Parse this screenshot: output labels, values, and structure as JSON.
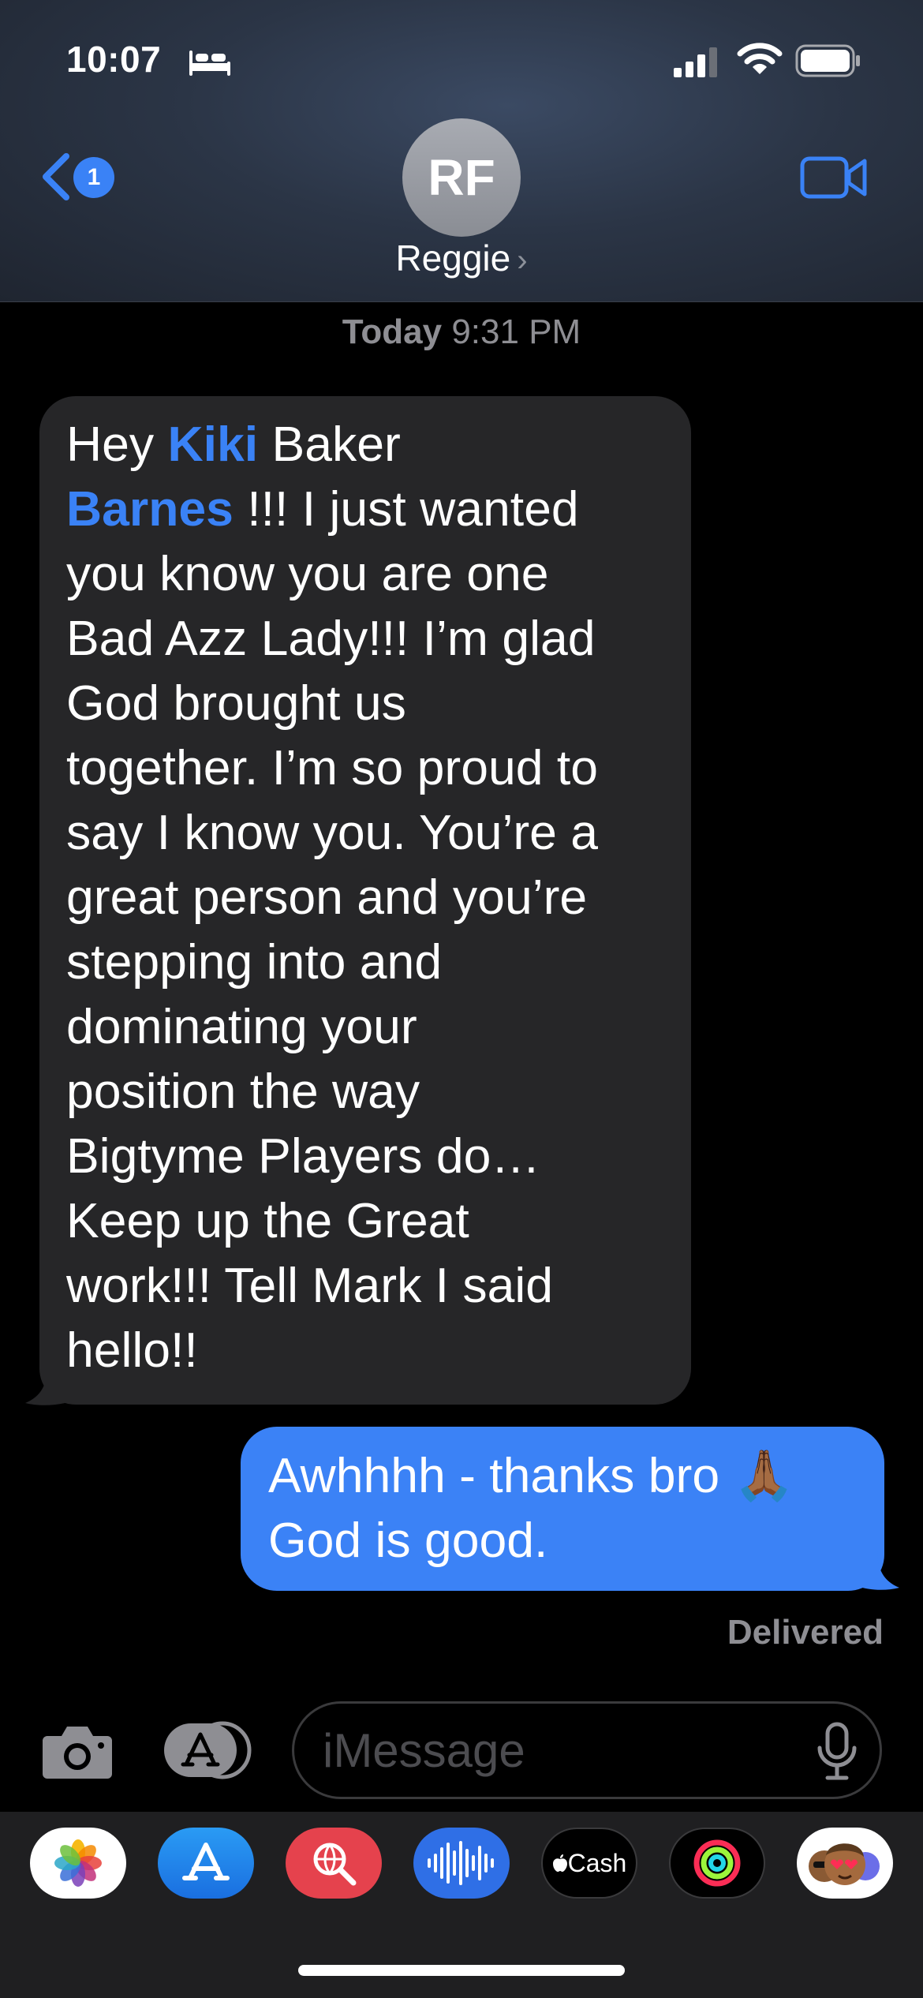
{
  "status_bar": {
    "time": "10:07",
    "icons": [
      "sleep-focus-icon",
      "cellular-signal-icon",
      "wifi-icon",
      "battery-icon"
    ]
  },
  "navigation": {
    "back_badge_count": "1",
    "contact_initials": "RF",
    "contact_name": "Reggie",
    "contact_chevron": "›"
  },
  "conversation": {
    "timestamp_day": "Today",
    "timestamp_time": "9:31 PM",
    "incoming": {
      "line1_pre": "Hey ",
      "highlight1": "Kiki",
      "line1_post": " Baker",
      "highlight2": "Barnes",
      "body": " !!! I just wanted\nyou know you are one\nBad Azz Lady!!! I’m glad\nGod brought us\ntogether. I’m so proud to\nsay I know you. You’re a\ngreat person and you’re\nstepping into and\ndominating your\nposition the way\nBigtyme Players do…\nKeep up the Great\nwork!!!  Tell Mark I said\nhello!!"
    },
    "outgoing": {
      "text": "Awhhhh - thanks bro 🙏🏾\nGod is good."
    },
    "delivery_status": "Delivered"
  },
  "input_bar": {
    "placeholder": "iMessage"
  },
  "app_tray": {
    "cash_label": "Cash",
    "apps": [
      "photos-app-icon",
      "app-store-icon",
      "search-images-app-icon",
      "audio-message-icon",
      "apple-cash-icon",
      "activity-icon",
      "memoji-stickers-icon"
    ]
  },
  "colors": {
    "accent": "#3a82f6",
    "incoming_bubble": "#262628",
    "outgoing_bubble": "#3b82f6",
    "secondary_text": "#8e8e93"
  }
}
